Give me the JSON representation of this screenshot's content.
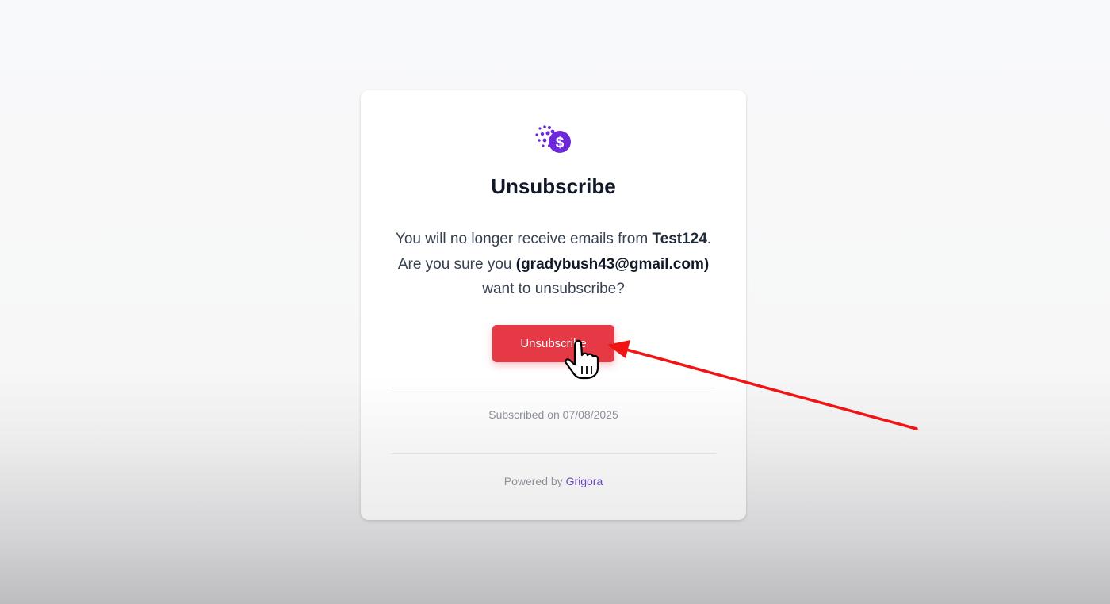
{
  "card": {
    "logo_icon": "coin-dollar-icon",
    "title": "Unsubscribe",
    "message": {
      "line1_prefix": "You will no longer receive emails from ",
      "sender": "Test124",
      "line1_suffix": ".",
      "line2_prefix": "Are you sure you ",
      "email": "(gradybush43@gmail.com)",
      "line3": "want to unsubscribe?"
    },
    "button_label": "Unsubscribe",
    "subscribed_text": "Subscribed on 07/08/2025",
    "powered_by_prefix": "Powered by ",
    "powered_by_link": "Grigora"
  },
  "overlay": {
    "cursor_icon": "hand-pointer-icon",
    "arrow_icon": "red-arrow-annotation",
    "arrow_color": "#f01414"
  },
  "colors": {
    "accent": "#6b46c1",
    "button": "#e63946",
    "title": "#111827"
  }
}
